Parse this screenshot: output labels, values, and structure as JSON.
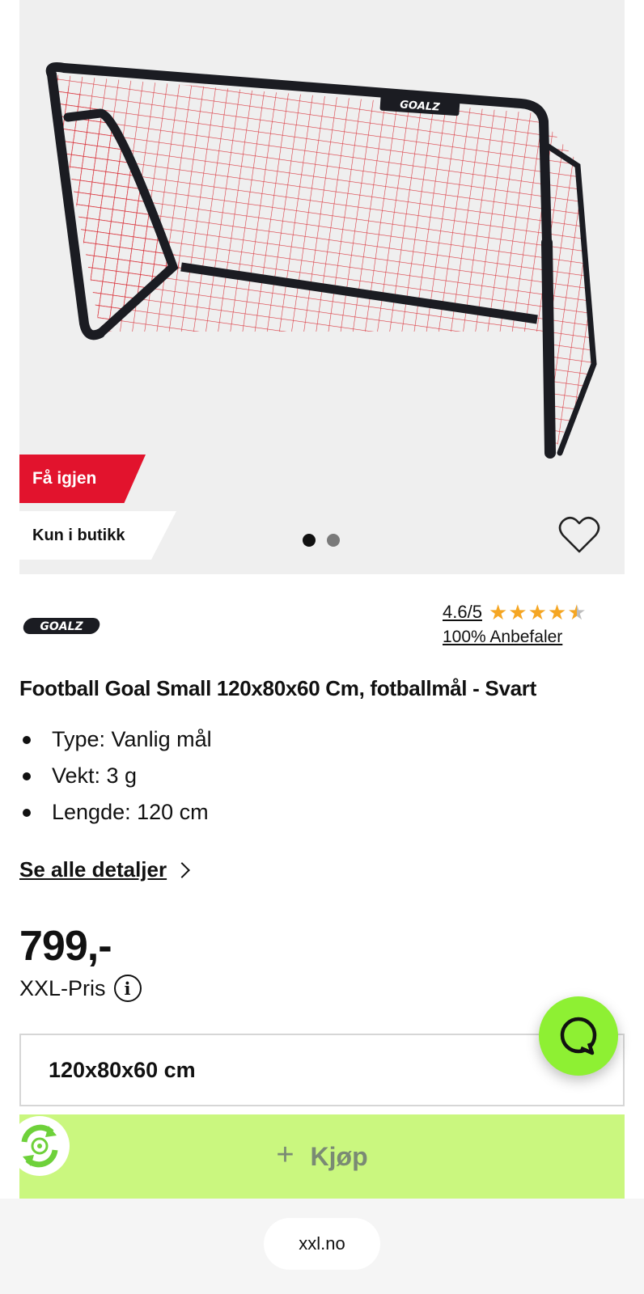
{
  "gallery": {
    "badge_again": "Få igjen",
    "badge_store": "Kun i butikk",
    "net_brand": "GOALZ",
    "colors": {
      "badge_red": "#e2132d",
      "net_red": "#d8262f",
      "frame": "#1b1c22"
    }
  },
  "product": {
    "brand_logo_text": "GOALZ",
    "rating_score": "4.6/5",
    "rating_value": 4.6,
    "rating_max": 5,
    "recommend": "100% Anbefaler",
    "title": "Football Goal Small 120x80x60 Cm, fotballmål - Svart",
    "specs": [
      "Type: Vanlig mål",
      "Vekt: 3 g",
      "Lengde: 120 cm"
    ],
    "details_link": "Se alle detaljer",
    "price": "799,-",
    "price_label": "XXL-Pris",
    "variant": "120x80x60 cm",
    "buy_label": "Kjøp",
    "colors": {
      "star": "#f5a623",
      "buy_bg": "#caf77f",
      "chat_bg": "#8ef033"
    }
  },
  "browser": {
    "url": "xxl.no"
  }
}
